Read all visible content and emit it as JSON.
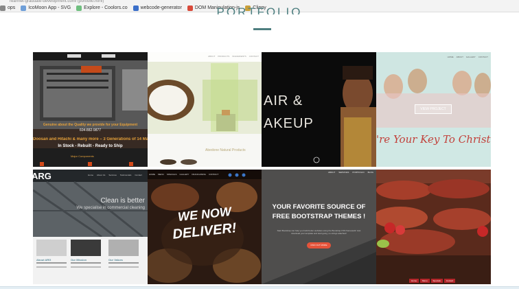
{
  "browser": {
    "url_fragment": "rearmet-graduate-development.com/ (portfolio.html)",
    "bookmarks": [
      {
        "label": "ops",
        "color": "#888888"
      },
      {
        "label": "IcoMoon App - SVG",
        "color": "#6f9fd8"
      },
      {
        "label": "Explore - Coolors.co",
        "color": "#6fbf7f"
      },
      {
        "label": "webcode-generator",
        "color": "#3b6fc9"
      },
      {
        "label": "DOM Manipulation-js",
        "color": "#d84a3a"
      },
      {
        "label": "Clippy",
        "color": "#c9a03b"
      }
    ]
  },
  "page": {
    "title": "PORTFOLIO"
  },
  "tiles": {
    "t1": {
      "headline": "Doosan and Hitachi & many more – 3 Generations of 14 Major Comp",
      "tagline": "Genuine about the Quality we provide for your Equipment",
      "phone": "604-882-9877",
      "stock": "In Stock - Rebuilt - Ready to Ship",
      "footer": "Major Components"
    },
    "t2": {
      "heading": "Abedone Natural Products",
      "nav": [
        "ABOUT",
        "PRODUCTS",
        "INGREDIENTS",
        "CONTACT"
      ]
    },
    "t3": {
      "line1": "AIR &",
      "line2": "AKEUP"
    },
    "t4": {
      "button": "VIEW PROJECT",
      "script": "'re Your Key To Christma",
      "nav": [
        "HOME",
        "ABOUT",
        "GALLERY",
        "CONTACT"
      ]
    },
    "t5": {
      "logo": "ARG",
      "headline": "Clean is better",
      "sub": "We specialise in commercial cleaning",
      "nav": [
        "Home",
        "About Us",
        "Services",
        "Testimonials",
        "Contact"
      ],
      "cols": [
        "About ARG",
        "Our Mission",
        "Our Values"
      ]
    },
    "t6": {
      "nav": [
        "HOME",
        "MENU",
        "SPECIALS",
        "GALLERY",
        "FRANCHISING",
        "CONTACT"
      ],
      "line1": "WE NOW",
      "line2": "DELIVER!"
    },
    "t7": {
      "nav": [
        "ABOUT",
        "SERVICES",
        "PORTFOLIO",
        "BLOG"
      ],
      "headline1": "YOUR FAVORITE SOURCE OF",
      "headline2": "FREE BOOTSTRAP THEMES !",
      "body": "Start Bootstrap can help you build better websites using the Bootstrap CSS framework! Just download your template and start going, no strings attached!",
      "cta": "FIND OUT MORE"
    },
    "t8": {
      "buttons": [
        "Home",
        "Menu",
        "Specials",
        "Contact"
      ]
    }
  }
}
